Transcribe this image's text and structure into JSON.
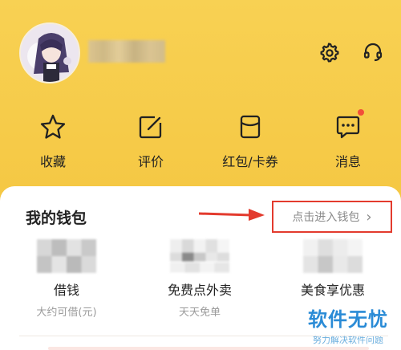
{
  "header": {
    "icons": {
      "settings": "gear-icon",
      "support": "headset-icon"
    }
  },
  "actions": [
    {
      "label": "收藏",
      "icon": "star-icon"
    },
    {
      "label": "评价",
      "icon": "edit-icon"
    },
    {
      "label": "红包/卡券",
      "icon": "coupon-icon"
    },
    {
      "label": "消息",
      "icon": "message-icon",
      "badge": true
    }
  ],
  "wallet": {
    "title": "我的钱包",
    "enter_label": "点击进入钱包",
    "enter_chevron": "›",
    "items": [
      {
        "name": "借钱",
        "sub": "大约可借(元)"
      },
      {
        "name": "免费点外卖",
        "sub": "天天免单"
      },
      {
        "name": "美食享优惠",
        "sub": ""
      }
    ]
  },
  "watermark": {
    "title": "软件无忧",
    "subtitle": "努力解决软件问题"
  },
  "colors": {
    "accent": "#f5c844",
    "highlight_border": "#e33b2e",
    "watermark": "#2a8bd6"
  }
}
